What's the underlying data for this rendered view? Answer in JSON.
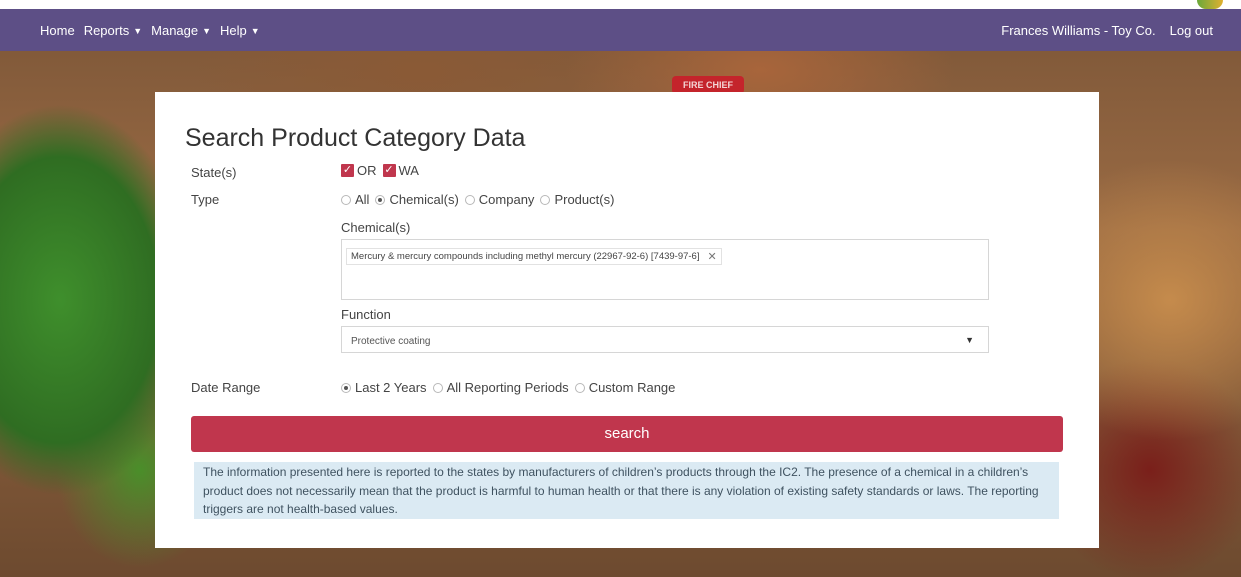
{
  "nav": {
    "left": [
      {
        "label": "Home",
        "dropdown": false
      },
      {
        "label": "Reports",
        "dropdown": true
      },
      {
        "label": "Manage",
        "dropdown": true
      },
      {
        "label": "Help",
        "dropdown": true
      }
    ],
    "user": "Frances Williams - Toy Co.",
    "logout": "Log out"
  },
  "background": {
    "sign_text": "FIRE CHIEF"
  },
  "form": {
    "title": "Search Product Category Data",
    "states_label": "State(s)",
    "states": [
      {
        "label": "OR",
        "checked": true
      },
      {
        "label": "WA",
        "checked": true
      }
    ],
    "type_label": "Type",
    "types": [
      {
        "label": "All",
        "selected": false
      },
      {
        "label": "Chemical(s)",
        "selected": true
      },
      {
        "label": "Company",
        "selected": false
      },
      {
        "label": "Product(s)",
        "selected": false
      }
    ],
    "chemicals_label": "Chemical(s)",
    "chemical_tag": "Mercury & mercury compounds including methyl mercury (22967-92-6) [7439-97-6]",
    "function_label": "Function",
    "function_value": "Protective coating",
    "date_label": "Date Range",
    "date_ranges": [
      {
        "label": "Last 2 Years",
        "selected": true
      },
      {
        "label": "All Reporting Periods",
        "selected": false
      },
      {
        "label": "Custom Range",
        "selected": false
      }
    ],
    "search_label": "search",
    "notice": "The information presented here is reported to the states by manufacturers of children’s products through the IC2. The presence of a chemical in a children’s product does not necessarily mean that the product is harmful to human health or that there is any violation of existing safety standards or laws. The reporting triggers are not health-based values."
  },
  "colors": {
    "navbar": "#5d4f86",
    "accent": "#c0364d",
    "notice_bg": "#dbeaf3"
  },
  "icons": {
    "caret": "caret-down-icon",
    "check": "checkmark-icon",
    "remove": "close-icon",
    "select_arrow": "chevron-down-icon"
  }
}
